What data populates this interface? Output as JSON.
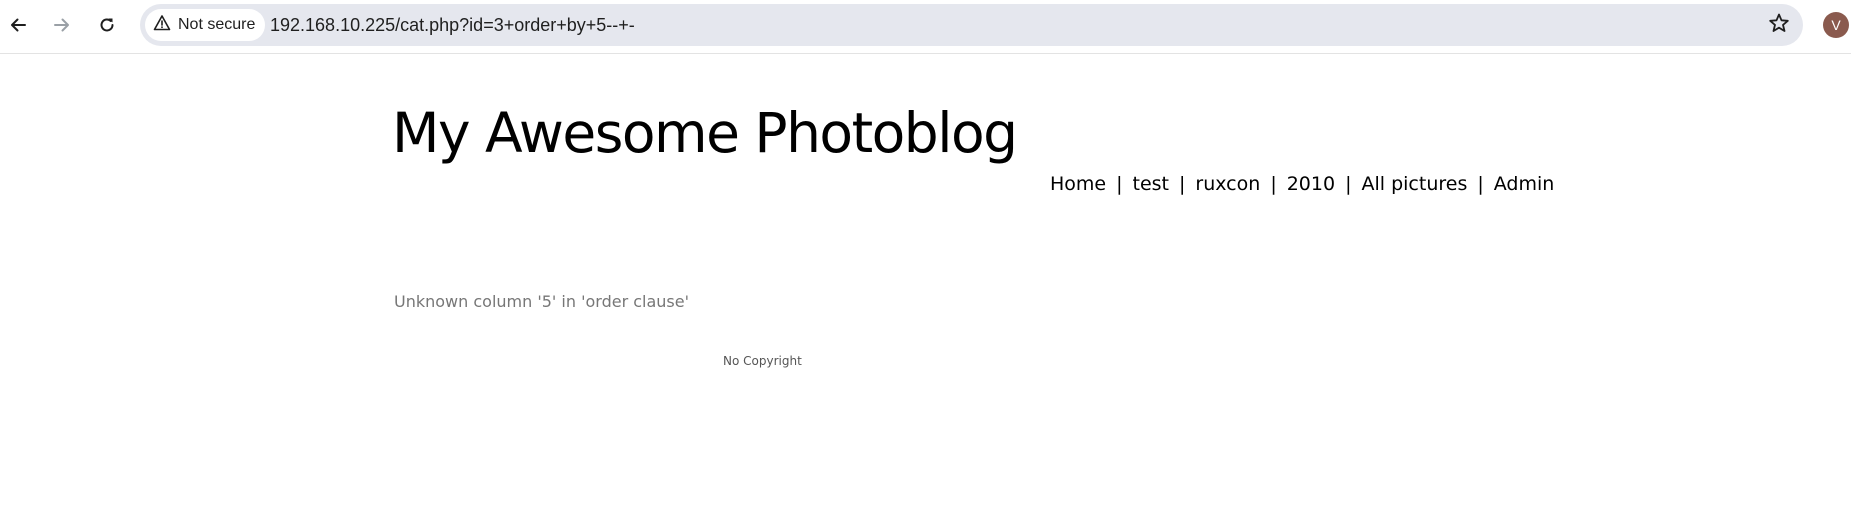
{
  "browser": {
    "security_label": "Not secure",
    "url": "192.168.10.225/cat.php?id=3+order+by+5--+-",
    "profile_initial": "V",
    "icons": {
      "back": "arrow-left-icon",
      "forward": "arrow-right-icon",
      "reload": "reload-icon",
      "security": "warning-triangle-icon",
      "bookmark": "star-icon"
    },
    "colors": {
      "omnibox_bg": "#e5e7ee",
      "avatar_bg": "#8a5a4e"
    }
  },
  "page": {
    "title": "My Awesome Photoblog",
    "nav": [
      {
        "label": "Home"
      },
      {
        "label": "test"
      },
      {
        "label": "ruxcon"
      },
      {
        "label": "2010"
      },
      {
        "label": "All pictures"
      },
      {
        "label": "Admin"
      }
    ],
    "nav_separator": "|",
    "error_message": "Unknown column '5' in 'order clause'",
    "footer": "No Copyright"
  }
}
